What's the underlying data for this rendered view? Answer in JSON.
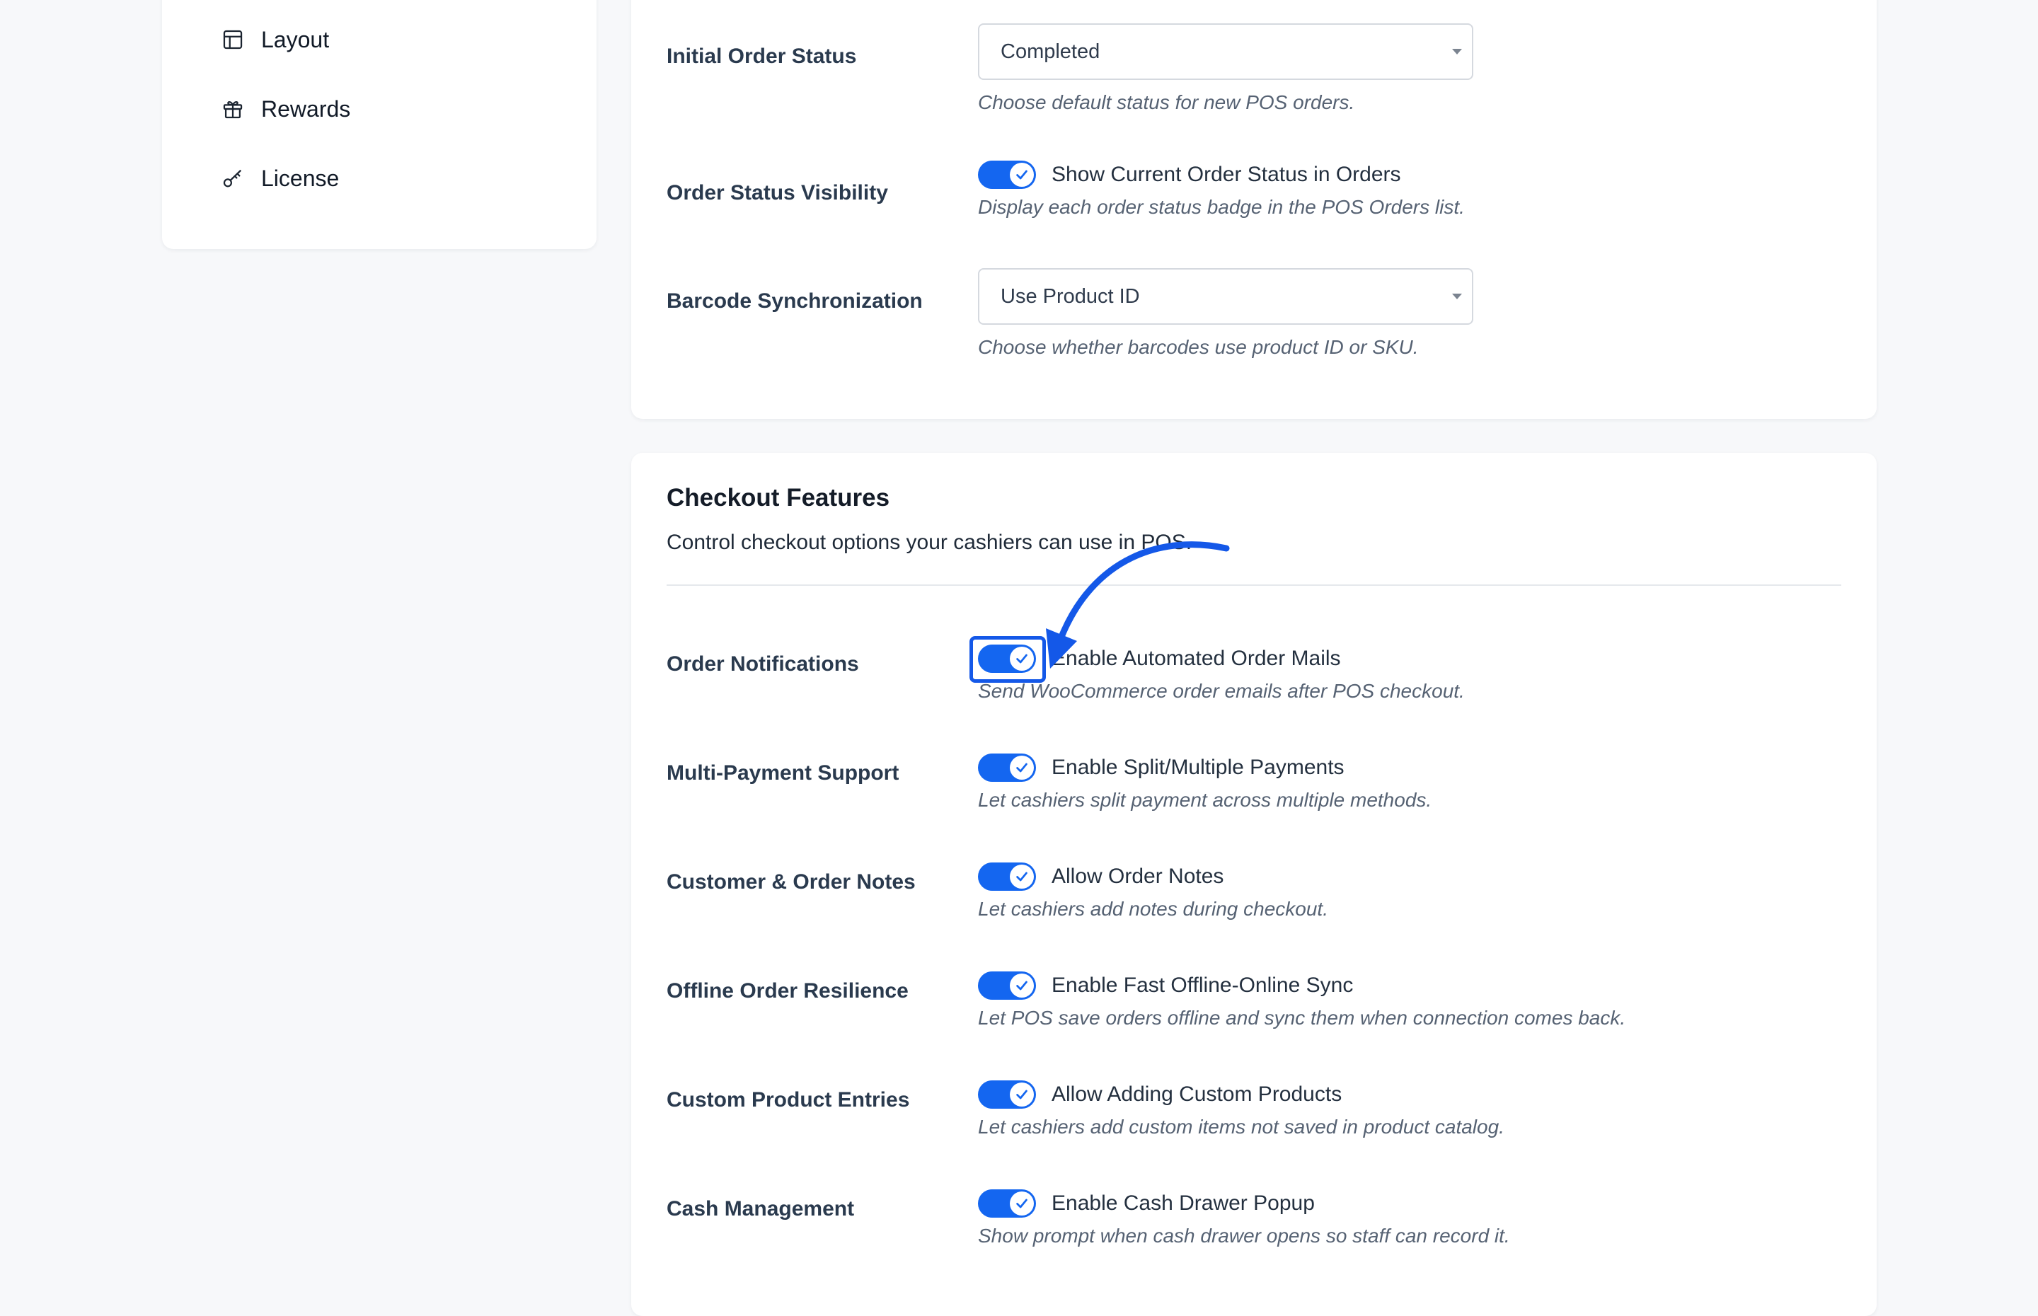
{
  "sidebar": {
    "items": [
      {
        "label": "Layout",
        "icon": "layout-icon"
      },
      {
        "label": "Rewards",
        "icon": "gift-icon"
      },
      {
        "label": "License",
        "icon": "key-icon"
      }
    ]
  },
  "general": {
    "initial_order_status": {
      "label": "Initial Order Status",
      "value": "Completed",
      "help": "Choose default status for new POS orders."
    },
    "order_status_visibility": {
      "label": "Order Status Visibility",
      "toggle_label": "Show Current Order Status in Orders",
      "enabled": true,
      "help": "Display each order status badge in the POS Orders list."
    },
    "barcode_sync": {
      "label": "Barcode Synchronization",
      "value": "Use Product ID",
      "help": "Choose whether barcodes use product ID or SKU."
    }
  },
  "checkout": {
    "title": "Checkout Features",
    "subtitle": "Control checkout options your cashiers can use in POS.",
    "rows": [
      {
        "label": "Order Notifications",
        "toggle_label": "Enable Automated Order Mails",
        "enabled": true,
        "help": "Send WooCommerce order emails after POS checkout."
      },
      {
        "label": "Multi-Payment Support",
        "toggle_label": "Enable Split/Multiple Payments",
        "enabled": true,
        "help": "Let cashiers split payment across multiple methods."
      },
      {
        "label": "Customer & Order Notes",
        "toggle_label": "Allow Order Notes",
        "enabled": true,
        "help": "Let cashiers add notes during checkout."
      },
      {
        "label": "Offline Order Resilience",
        "toggle_label": "Enable Fast Offline-Online Sync",
        "enabled": true,
        "help": "Let POS save orders offline and sync them when connection comes back."
      },
      {
        "label": "Custom Product Entries",
        "toggle_label": "Allow Adding Custom Products",
        "enabled": true,
        "help": "Let cashiers add custom items not saved in product catalog."
      },
      {
        "label": "Cash Management",
        "toggle_label": "Enable Cash Drawer Popup",
        "enabled": true,
        "help": "Show prompt when cash drawer opens so staff can record it."
      }
    ]
  },
  "colors": {
    "accent": "#1466f0",
    "annotation": "#1458e8",
    "background": "#f7f8fa"
  }
}
